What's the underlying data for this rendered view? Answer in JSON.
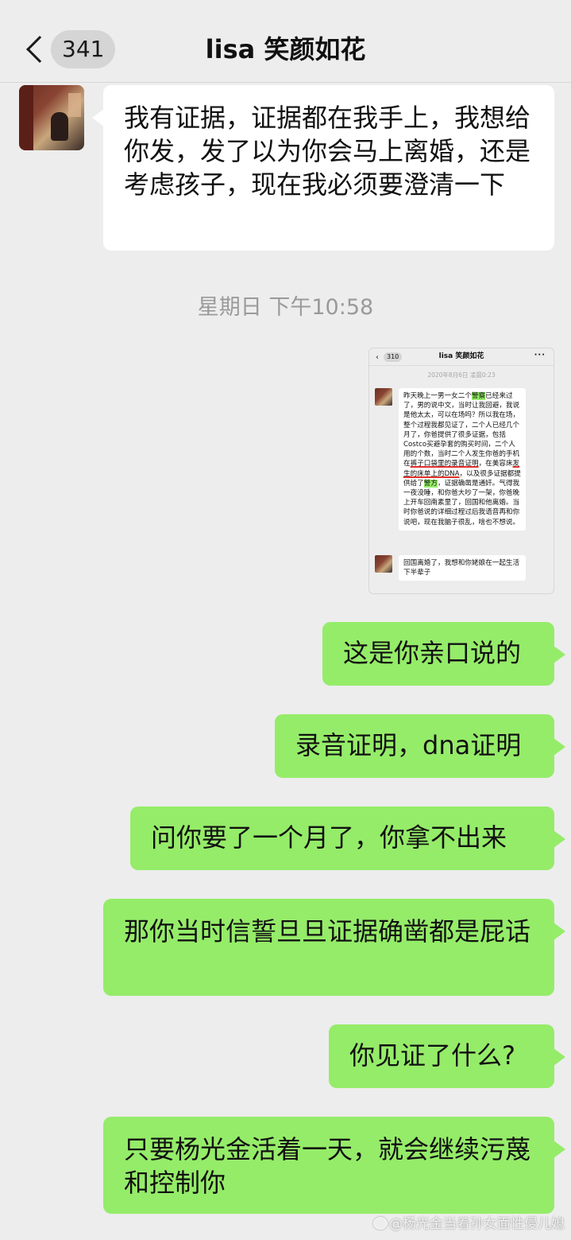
{
  "header": {
    "back_count": "341",
    "title": "lisa 笑颜如花"
  },
  "messages": [
    {
      "side": "left",
      "text": "我有证据，证据都在我手上，我想给你发，发了以为你会马上离婚，还是考虑孩子，现在我必须要澄清一下"
    },
    {
      "side": "right",
      "text": "这是你亲口说的"
    },
    {
      "side": "right",
      "text": "录音证明，dna证明"
    },
    {
      "side": "right",
      "text": "问你要了一个月了，你拿不出来"
    },
    {
      "side": "right",
      "text": "那你当时信誓旦旦证据确凿都是屁话"
    },
    {
      "side": "right",
      "text": "你见证了什么?"
    },
    {
      "side": "right",
      "text": "只要杨光金活着一天，就会继续污蔑和控制你"
    }
  ],
  "timestamp": "星期日 下午10:58",
  "embedded_screenshot": {
    "back_count": "310",
    "title": "lisa 笑颜如花",
    "more_icon": "···",
    "time": "2020年8月6日 凌晨0:23",
    "message1_parts": [
      "昨天晚上一男一女二个",
      "警察",
      "已经来过了，男的说中文，当时让我回避，我说是他太太，可以在场吗？所以我在场，整个过程我都见证了，二个人已经几个月了，你爸提供了很多证据，包括Costco买避孕套的购买时间，二个人用的个数，当时二个人发生你爸的手机在",
      "裤子口袋里的录音证明",
      "，在美容床",
      "发生的床单上的DNA",
      "，以及很多证据都提供给了",
      "警方",
      "，证据确凿是通奸。气得我一夜没睡，和你爸大吵了一架，你爸晚上开车回南素里了，回国和他离婚。当时你爸说的详细过程过后我语音再和你说吧，现在我脑子很乱，啥也不想说。"
    ],
    "message2": "回国离婚了，我想和你姥娘在一起生活下半辈子"
  },
  "watermark": "@杨光金当着孙女面性侵儿媳"
}
